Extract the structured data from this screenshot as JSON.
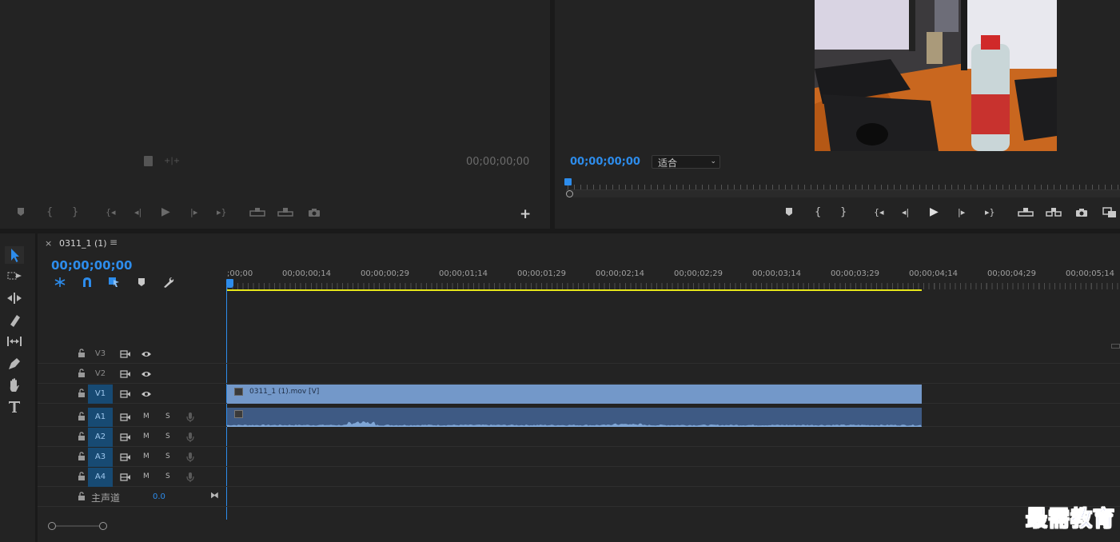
{
  "source_monitor": {
    "timecode": "00;00;00;00",
    "add_button": "+"
  },
  "program_monitor": {
    "timecode": "00;00;00;00",
    "fit_select": "适合"
  },
  "timeline": {
    "tab_close": "×",
    "tab_title": "0311_1 (1)",
    "tab_menu": "≡",
    "timecode": "00;00;00;00",
    "ruler": [
      ";00;00",
      "00;00;00;14",
      "00;00;00;29",
      "00;00;01;14",
      "00;00;01;29",
      "00;00;02;14",
      "00;00;02;29",
      "00;00;03;14",
      "00;00;03;29",
      "00;00;04;14",
      "00;00;04;29",
      "00;00;05;14"
    ],
    "video_tracks": [
      {
        "name": "V3",
        "active": false
      },
      {
        "name": "V2",
        "active": false
      },
      {
        "name": "V1",
        "active": true
      }
    ],
    "audio_tracks": [
      {
        "name": "A1",
        "m": "M",
        "s": "S"
      },
      {
        "name": "A2",
        "m": "M",
        "s": "S"
      },
      {
        "name": "A3",
        "m": "M",
        "s": "S"
      },
      {
        "name": "A4",
        "m": "M",
        "s": "S"
      }
    ],
    "master": {
      "label": "主声道",
      "value": "0.0"
    },
    "video_clip": "0311_1 (1).mov [V]"
  },
  "colors": {
    "accent": "#2d8ceb",
    "clip_video": "#7398c9",
    "clip_audio": "#3e5a84",
    "work_area": "#e6e61a"
  },
  "watermark": "最需教育"
}
